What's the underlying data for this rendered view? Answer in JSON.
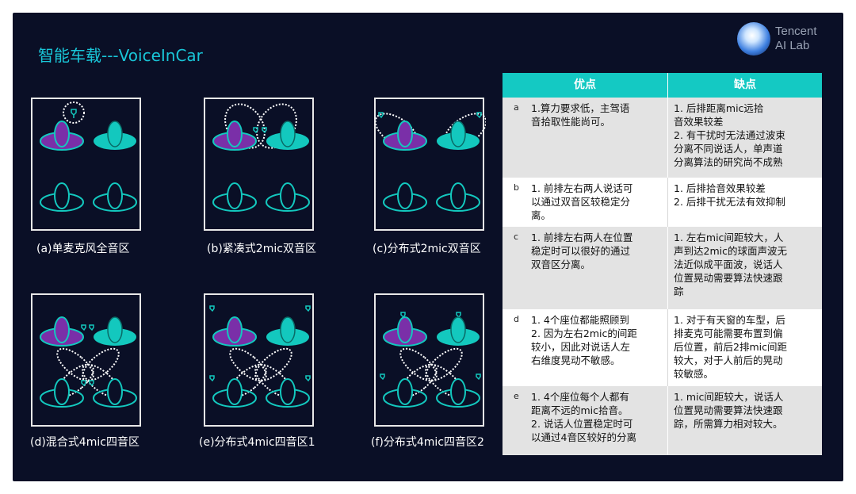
{
  "header": {
    "title": "智能车载---VoiceInCar",
    "logo": {
      "line1": "Tencent",
      "line2": "AI Lab",
      "icon": "tencent-ai-lab-logo"
    }
  },
  "colors": {
    "background": "#0a0f26",
    "accent": "#19c6d8",
    "purple_seat": "#7a2fa8",
    "teal_seat": "#13c8be",
    "table_header": "#14c9c3"
  },
  "diagrams": [
    {
      "caption": "(a)单麦克风全音区"
    },
    {
      "caption": "(b)紧凑式2mic双音区"
    },
    {
      "caption": "(c)分布式2mic双音区"
    },
    {
      "caption": "(d)混合式4mic四音区"
    },
    {
      "caption": "(e)分布式4mic四音区1"
    },
    {
      "caption": "(f)分布式4mic四音区2"
    }
  ],
  "table": {
    "headers": {
      "pro": "优点",
      "con": "缺点"
    },
    "rows": [
      {
        "label": "a",
        "pro": "1.算力要求低，主驾语\n音拾取性能尚可。",
        "con": "1. 后排距离mic远拾\n音效果较差\n2. 有干扰时无法通过波束\n分离不同说话人，单声道\n分离算法的研究尚不成熟"
      },
      {
        "label": "b",
        "pro": "1. 前排左右两人说话可\n以通过双音区较稳定分\n离。",
        "con": "1. 后排拾音效果较差\n2. 后排干扰无法有效抑制"
      },
      {
        "label": "c",
        "pro": "1. 前排左右两人在位置\n稳定时可以很好的通过\n双音区分离。",
        "con": "1. 左右mic间距较大，人\n声到达2mic的球面声波无\n法近似成平面波，说话人\n位置晃动需要算法快速跟\n踪"
      },
      {
        "label": "d",
        "pro": "1. 4个座位都能照顾到\n2. 因为左右2mic的间距\n较小，因此对说话人左\n右维度晃动不敏感。",
        "con": "1. 对于有天窗的车型，后\n排麦克可能需要布置到偏\n后位置，前后2排mic间距\n较大，对于人前后的晃动\n较敏感。"
      },
      {
        "label": "e",
        "pro": "1.  4个座位每个人都有\n距离不远的mic拾音。\n2. 说话人位置稳定时可\n以通过4音区较好的分离",
        "con": "1. mic间距较大，说话人\n位置晃动需要算法快速跟\n踪，所需算力相对较大。"
      }
    ]
  }
}
